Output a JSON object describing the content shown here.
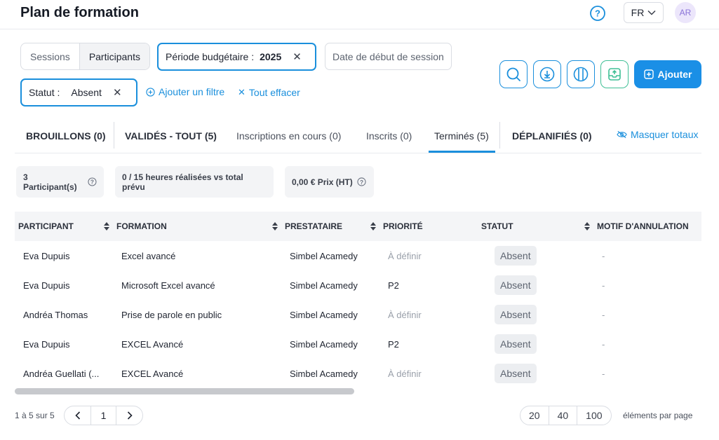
{
  "header": {
    "title": "Plan de formation",
    "lang": "FR",
    "avatar_initials": "AR"
  },
  "view_toggle": {
    "sessions": "Sessions",
    "participants": "Participants",
    "selected": "Participants"
  },
  "filters": {
    "periode_label": "Période budgétaire :",
    "periode_value": "2025",
    "date_debut": "Date de début de session",
    "statut_label": "Statut :",
    "statut_value": "Absent",
    "add_filter": "Ajouter un filtre",
    "clear_all": "Tout effacer"
  },
  "toolbar": {
    "add_label": "Ajouter"
  },
  "tabs": [
    {
      "label": "BROUILLONS (0)"
    },
    {
      "label": "VALIDÉS - TOUT (5)"
    },
    {
      "label": "Inscriptions en cours (0)"
    },
    {
      "label": "Inscrits (0)"
    },
    {
      "label": "Terminés (5)"
    },
    {
      "label": "DÉPLANIFIÉS (0)"
    }
  ],
  "active_tab": "Terminés (5)",
  "hide_totals": "Masquer totaux",
  "summary": {
    "participants": "3 Participant(s)",
    "hours": "0 / 15 heures réalisées vs total prévu",
    "price": "0,00 € Prix (HT)"
  },
  "table": {
    "columns": [
      "PARTICIPANT",
      "FORMATION",
      "PRESTATAIRE",
      "PRIORITÉ",
      "STATUT",
      "MOTIF D'ANNULATION"
    ],
    "rows": [
      {
        "participant": "Eva Dupuis",
        "formation": "Excel avancé",
        "prestataire": "Simbel Acamedy",
        "priorite": "À définir",
        "statut": "Absent",
        "motif": "-"
      },
      {
        "participant": "Eva Dupuis",
        "formation": "Microsoft Excel avancé",
        "prestataire": "Simbel Acamedy",
        "priorite": "P2",
        "statut": "Absent",
        "motif": "-"
      },
      {
        "participant": "Andréa Thomas",
        "formation": "Prise de parole en public",
        "prestataire": "Simbel Acamedy",
        "priorite": "À définir",
        "statut": "Absent",
        "motif": "-"
      },
      {
        "participant": "Eva Dupuis",
        "formation": "EXCEL Avancé",
        "prestataire": "Simbel Acamedy",
        "priorite": "P2",
        "statut": "Absent",
        "motif": "-"
      },
      {
        "participant": "Andréa Guellati (...",
        "formation": "EXCEL Avancé",
        "prestataire": "Simbel Acamedy",
        "priorite": "À définir",
        "statut": "Absent",
        "motif": "-"
      }
    ]
  },
  "pagination": {
    "info": "1 à 5 sur 5",
    "prev": "‹",
    "page": "1",
    "next": "›",
    "page_sizes": [
      "20",
      "40",
      "100"
    ],
    "selected_size": "20",
    "per_page_label": "éléments par page"
  },
  "colors": {
    "accent": "#1a8fdc",
    "button": "#1a8fe6",
    "green": "#3fbf95"
  }
}
